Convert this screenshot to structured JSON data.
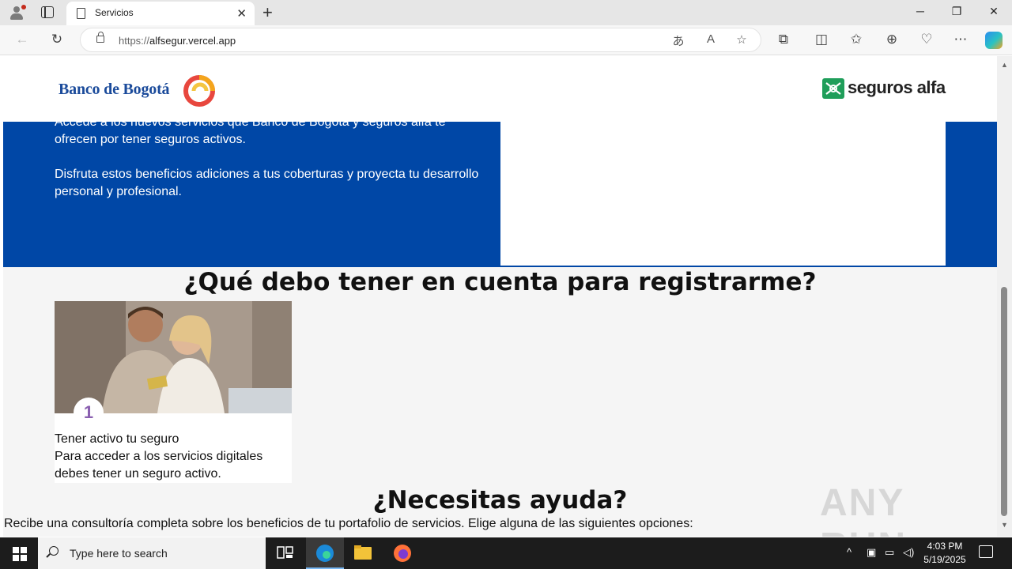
{
  "browser": {
    "tab_title": "Servicios",
    "new_tab_label": "+",
    "url_protocol": "https://",
    "url_host": "alfsegur.vercel.app"
  },
  "site": {
    "bank_logo_text": "Banco de Bogotá",
    "insurer_logo_text": "seguros alfa",
    "hero_paragraph_1": "Accede a los nuevos servicios que Banco de Bogotá y seguros alfa te ofrecen por tener seguros activos.",
    "hero_paragraph_2": "Disfruta estos beneficios adiciones a tus coberturas y proyecta tu desarrollo personal y profesional.",
    "section_title": "¿Qué debo tener en cuenta para registrarme?",
    "steps": [
      {
        "number": "1",
        "title": "Tener activo tu seguro",
        "description": "Para acceder a los servicios digitales debes tener un seguro activo."
      }
    ],
    "help_title": "¿Necesitas ayuda?",
    "help_description": "Recibe una consultoría completa sobre los beneficios de tu portafolio de servicios. Elige alguna de las siguientes opciones:",
    "brand_blue": "#0047a6"
  },
  "watermark": "ANY RUN",
  "taskbar": {
    "search_placeholder": "Type here to search",
    "time": "4:03 PM",
    "date": "5/19/2025"
  }
}
